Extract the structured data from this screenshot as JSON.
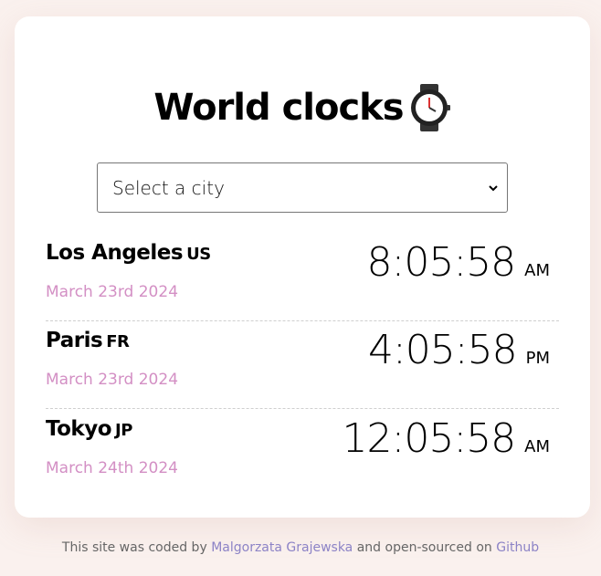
{
  "header": {
    "title": "World clocks",
    "icon": "watch-icon"
  },
  "select": {
    "label": "Select a city"
  },
  "cities": [
    {
      "city": "Los Angeles",
      "country": "US",
      "date": "March 23rd 2024",
      "time": "8:05:58",
      "ampm": "AM"
    },
    {
      "city": "Paris",
      "country": "FR",
      "date": "March 23rd 2024",
      "time": "4:05:58",
      "ampm": "PM"
    },
    {
      "city": "Tokyo",
      "country": "JP",
      "date": "March 24th 2024",
      "time": "12:05:58",
      "ampm": "AM"
    }
  ],
  "footer": {
    "prefix": "This site was coded by",
    "author": "Malgorzata Grajewska",
    "middle": "and open-sourced on",
    "repo": "Github"
  },
  "colors": {
    "accent": "#d38fc4",
    "link": "#8c83c6",
    "background": "#faf1ee"
  }
}
